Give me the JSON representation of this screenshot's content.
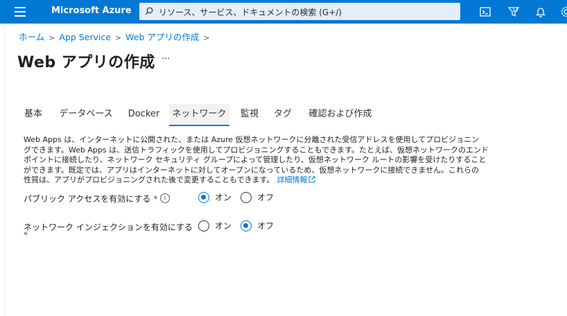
{
  "topbar": {
    "brand": "Microsoft Azure",
    "search_placeholder": "リソース、サービス、ドキュメントの検索 (G+/)",
    "icons": [
      "menu-icon",
      "search-icon",
      "cloud-shell-icon",
      "directory-filter-icon",
      "notifications-icon",
      "settings-icon"
    ]
  },
  "breadcrumb": {
    "items": [
      "ホーム",
      "App Service",
      "Web アプリの作成"
    ]
  },
  "page": {
    "title": "Web アプリの作成",
    "more": "···"
  },
  "tabs": [
    "基本",
    "データベース",
    "Docker",
    "ネットワーク",
    "監視",
    "タグ",
    "確認および作成"
  ],
  "active_tab": "ネットワーク",
  "description": {
    "lines": [
      "Web Apps は、インターネットに公開された、または Azure 仮想ネットワークに分離された受信アドレスを使用してプロビジョニン",
      "グできます。Web Apps は、送信トラフィックを使用してプロビジョニングすることもできます。たとえば、仮想ネットワークのエンド",
      "ポイントに接続したり、ネットワーク セキュリティ グループによって管理したり、仮想ネットワーク ルートの影響を受けたりすること",
      "ができます。既定では、アプリはインターネットに対してオープンになっているため、仮想ネットワークに接続できません。これらの",
      "性質は、アプリがプロビジョニングされた後で変更することもできます。"
    ],
    "link": "詳細情報"
  },
  "public_access": {
    "label": "パブリック アクセスを有効にする",
    "required": "*",
    "info": "i",
    "on": "オン",
    "off": "オフ",
    "selected": "オン"
  },
  "network_injection": {
    "label": "ネットワーク インジェクションを有効にする",
    "required": "*",
    "on": "オン",
    "off": "オフ",
    "selected": "オフ"
  },
  "colors": {
    "accent": "#0078d4",
    "topbar": "#0078d4",
    "required": "#a4262c"
  }
}
